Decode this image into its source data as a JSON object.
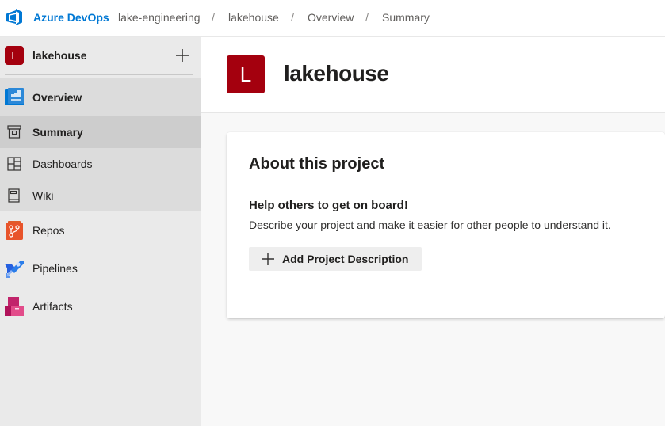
{
  "topbar": {
    "brand": "Azure DevOps",
    "breadcrumbs": [
      "lake-engineering",
      "lakehouse",
      "Overview",
      "Summary"
    ],
    "separator": "/"
  },
  "sidebar": {
    "project_initial": "L",
    "project_name": "lakehouse",
    "items": [
      {
        "label": "Overview",
        "icon": "overview-icon"
      },
      {
        "label": "Summary",
        "icon": "summary-icon",
        "selected": true
      },
      {
        "label": "Dashboards",
        "icon": "dashboards-icon"
      },
      {
        "label": "Wiki",
        "icon": "wiki-icon"
      },
      {
        "label": "Repos",
        "icon": "repos-icon"
      },
      {
        "label": "Pipelines",
        "icon": "pipelines-icon"
      },
      {
        "label": "Artifacts",
        "icon": "artifacts-icon"
      }
    ]
  },
  "main": {
    "project_initial": "L",
    "title": "lakehouse",
    "card": {
      "title": "About this project",
      "subtitle": "Help others to get on board!",
      "description": "Describe your project and make it easier for other people to understand it.",
      "button_label": "Add Project Description"
    }
  },
  "colors": {
    "brand": "#0078d4",
    "project_badge": "#a4000e",
    "sidebar_bg": "#eaeaea",
    "selected_bg": "#cdcdcd"
  }
}
